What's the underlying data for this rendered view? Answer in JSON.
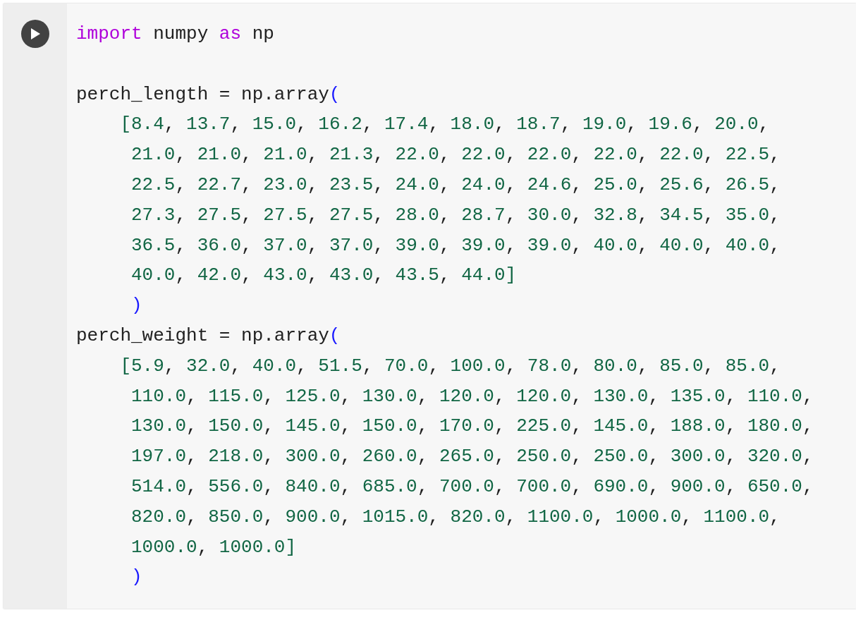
{
  "cell": {
    "lines": [
      {
        "kind": "plain",
        "tokens": [
          {
            "kind": "keyword",
            "text": "import"
          },
          {
            "kind": "text",
            "text": " numpy "
          },
          {
            "kind": "keyword",
            "text": "as"
          },
          {
            "kind": "text",
            "text": " np"
          }
        ]
      },
      {
        "kind": "blank"
      },
      {
        "kind": "plain",
        "tokens": [
          {
            "kind": "text",
            "text": "perch_length = np.array"
          },
          {
            "kind": "paren",
            "text": "("
          }
        ]
      },
      {
        "kind": "array-start",
        "tokens": [
          {
            "kind": "values",
            "text": "[8.4, 13.7, 15.0, 16.2, 17.4, 18.0, 18.7, 19.0, 19.6, 20.0,"
          }
        ]
      },
      {
        "kind": "array-cont",
        "tokens": [
          {
            "kind": "values",
            "text": "21.0, 21.0, 21.0, 21.3, 22.0, 22.0, 22.0, 22.0, 22.0, 22.5,"
          }
        ]
      },
      {
        "kind": "array-cont",
        "tokens": [
          {
            "kind": "values",
            "text": "22.5, 22.7, 23.0, 23.5, 24.0, 24.0, 24.6, 25.0, 25.6, 26.5,"
          }
        ]
      },
      {
        "kind": "array-cont",
        "tokens": [
          {
            "kind": "values",
            "text": "27.3, 27.5, 27.5, 27.5, 28.0, 28.7, 30.0, 32.8, 34.5, 35.0,"
          }
        ]
      },
      {
        "kind": "array-cont",
        "tokens": [
          {
            "kind": "values",
            "text": "36.5, 36.0, 37.0, 37.0, 39.0, 39.0, 39.0, 40.0, 40.0, 40.0,"
          }
        ]
      },
      {
        "kind": "array-cont",
        "tokens": [
          {
            "kind": "values",
            "text": "40.0, 42.0, 43.0, 43.0, 43.5, 44.0]"
          }
        ]
      },
      {
        "kind": "array-cont",
        "tokens": [
          {
            "kind": "paren",
            "text": ")"
          }
        ]
      },
      {
        "kind": "plain",
        "tokens": [
          {
            "kind": "text",
            "text": "perch_weight = np.array"
          },
          {
            "kind": "paren",
            "text": "("
          }
        ]
      },
      {
        "kind": "array-start",
        "tokens": [
          {
            "kind": "values",
            "text": "[5.9, 32.0, 40.0, 51.5, 70.0, 100.0, 78.0, 80.0, 85.0, 85.0,"
          }
        ]
      },
      {
        "kind": "array-cont",
        "tokens": [
          {
            "kind": "values",
            "text": "110.0, 115.0, 125.0, 130.0, 120.0, 120.0, 130.0, 135.0, 110.0,"
          }
        ]
      },
      {
        "kind": "array-cont",
        "tokens": [
          {
            "kind": "values",
            "text": "130.0, 150.0, 145.0, 150.0, 170.0, 225.0, 145.0, 188.0, 180.0,"
          }
        ]
      },
      {
        "kind": "array-cont",
        "tokens": [
          {
            "kind": "values",
            "text": "197.0, 218.0, 300.0, 260.0, 265.0, 250.0, 250.0, 300.0, 320.0,"
          }
        ]
      },
      {
        "kind": "array-cont",
        "tokens": [
          {
            "kind": "values",
            "text": "514.0, 556.0, 840.0, 685.0, 700.0, 700.0, 690.0, 900.0, 650.0,"
          }
        ]
      },
      {
        "kind": "array-cont",
        "tokens": [
          {
            "kind": "values",
            "text": "820.0, 850.0, 900.0, 1015.0, 820.0, 1100.0, 1000.0, 1100.0,"
          }
        ]
      },
      {
        "kind": "array-cont",
        "tokens": [
          {
            "kind": "values",
            "text": "1000.0, 1000.0]"
          }
        ]
      },
      {
        "kind": "array-cont",
        "tokens": [
          {
            "kind": "paren",
            "text": ")"
          }
        ]
      }
    ]
  }
}
